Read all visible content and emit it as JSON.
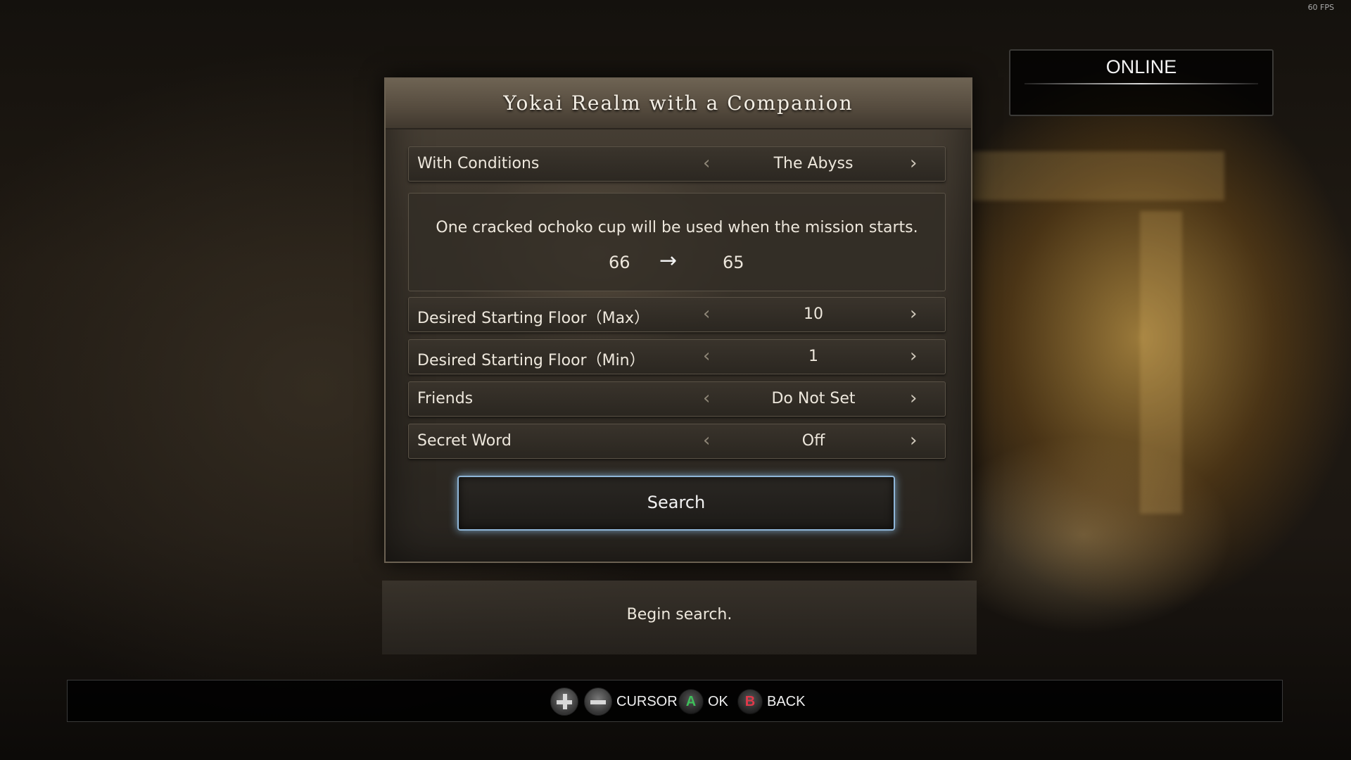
{
  "hud": {
    "fps": "60 FPS"
  },
  "online_panel": {
    "title": "ONLINE"
  },
  "dialog": {
    "title": "Yokai Realm with a Companion",
    "rows": [
      {
        "label": "With Conditions",
        "value": "The Abyss"
      },
      {
        "label": "Desired Starting Floor（Max）",
        "value": "10"
      },
      {
        "label": "Desired Starting Floor（Min）",
        "value": "1"
      },
      {
        "label": "Friends",
        "value": "Do Not Set"
      },
      {
        "label": "Secret Word",
        "value": "Off"
      }
    ],
    "info": {
      "text": "One cracked ochoko cup will be used when the mission starts.",
      "from": "66",
      "arrow": "→",
      "to": "65"
    },
    "search_label": "Search"
  },
  "description": "Begin search.",
  "hints": {
    "cursor_label": "CURSOR",
    "ok_key": "A",
    "ok_label": "OK",
    "back_key": "B",
    "back_label": "BACK"
  },
  "colors": {
    "ok_key": "#3fbf5a",
    "back_key": "#e0394a",
    "focus_glow": "#8fb6d8"
  }
}
